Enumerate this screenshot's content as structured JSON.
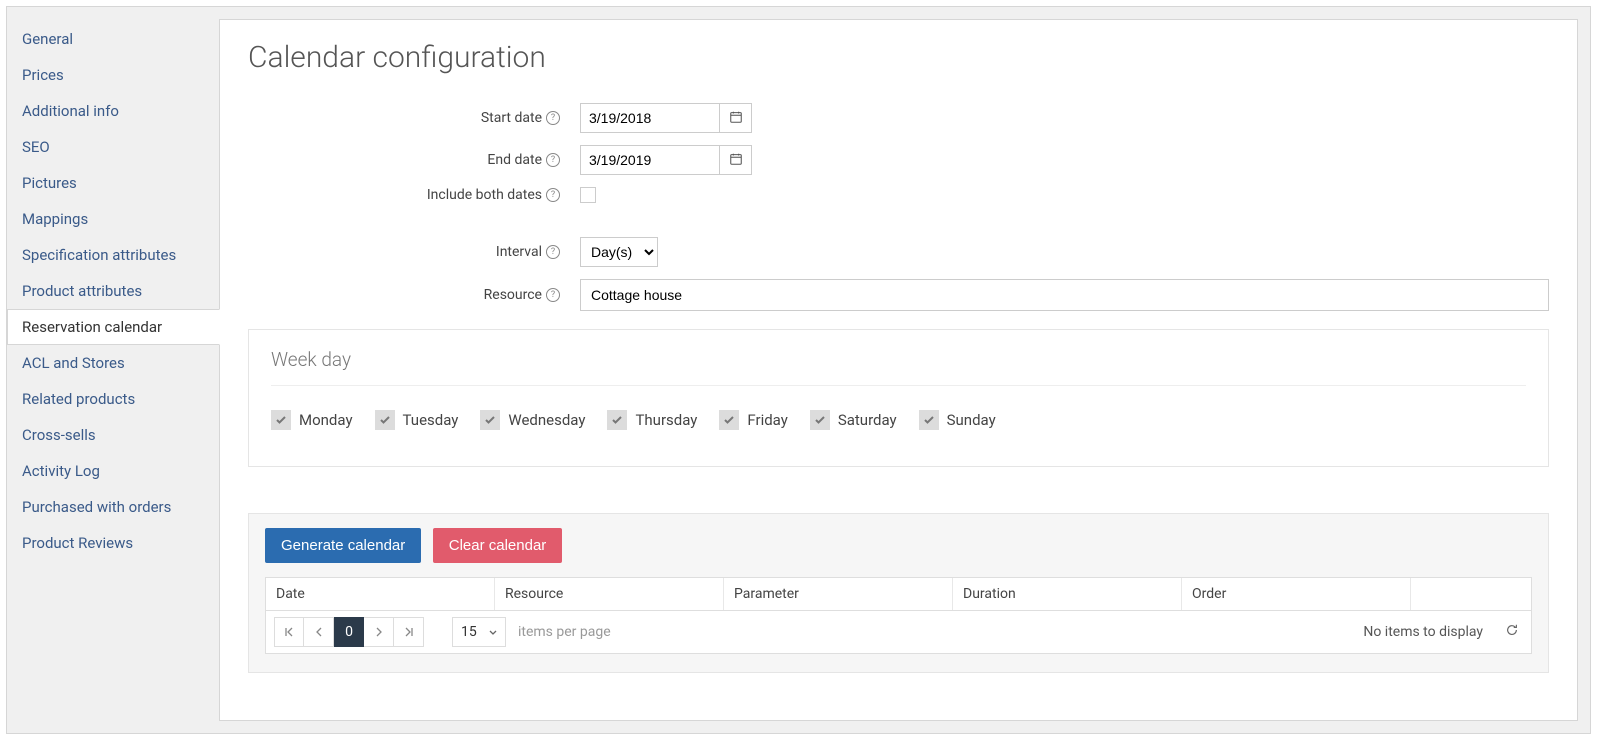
{
  "sidebar": {
    "items": [
      {
        "label": "General",
        "active": false
      },
      {
        "label": "Prices",
        "active": false
      },
      {
        "label": "Additional info",
        "active": false
      },
      {
        "label": "SEO",
        "active": false
      },
      {
        "label": "Pictures",
        "active": false
      },
      {
        "label": "Mappings",
        "active": false
      },
      {
        "label": "Specification attributes",
        "active": false
      },
      {
        "label": "Product attributes",
        "active": false
      },
      {
        "label": "Reservation calendar",
        "active": true
      },
      {
        "label": "ACL and Stores",
        "active": false
      },
      {
        "label": "Related products",
        "active": false
      },
      {
        "label": "Cross-sells",
        "active": false
      },
      {
        "label": "Activity Log",
        "active": false
      },
      {
        "label": "Purchased with orders",
        "active": false
      },
      {
        "label": "Product Reviews",
        "active": false
      }
    ]
  },
  "page_title": "Calendar configuration",
  "form": {
    "start_date": {
      "label": "Start date",
      "value": "3/19/2018"
    },
    "end_date": {
      "label": "End date",
      "value": "3/19/2019"
    },
    "include_both": {
      "label": "Include both dates",
      "checked": false
    },
    "interval": {
      "label": "Interval",
      "value": "Day(s)",
      "options": [
        "Day(s)"
      ]
    },
    "resource": {
      "label": "Resource",
      "value": "Cottage house"
    }
  },
  "weekday_panel": {
    "title": "Week day",
    "days": [
      {
        "label": "Monday",
        "checked": true
      },
      {
        "label": "Tuesday",
        "checked": true
      },
      {
        "label": "Wednesday",
        "checked": true
      },
      {
        "label": "Thursday",
        "checked": true
      },
      {
        "label": "Friday",
        "checked": true
      },
      {
        "label": "Saturday",
        "checked": true
      },
      {
        "label": "Sunday",
        "checked": true
      }
    ]
  },
  "actions": {
    "generate": "Generate calendar",
    "clear": "Clear calendar"
  },
  "grid": {
    "columns": [
      "Date",
      "Resource",
      "Parameter",
      "Duration",
      "Order"
    ],
    "rows": [],
    "pager": {
      "current_page": "0",
      "page_size": "15",
      "items_per_page_label": "items per page",
      "status": "No items to display"
    }
  }
}
